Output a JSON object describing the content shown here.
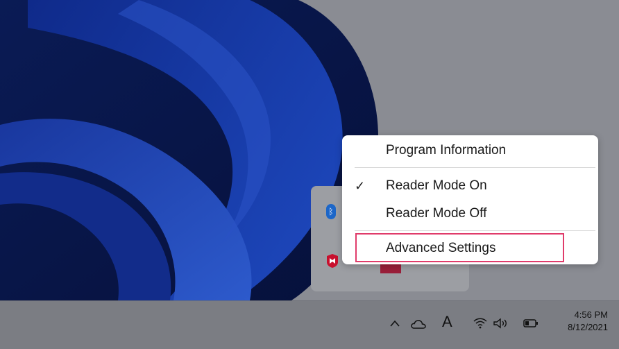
{
  "context_menu": {
    "items": [
      {
        "label": "Program Information",
        "checked": false
      },
      {
        "label": "Reader Mode On",
        "checked": true
      },
      {
        "label": "Reader Mode Off",
        "checked": false
      },
      {
        "label": "Advanced Settings",
        "checked": false,
        "highlighted": true
      }
    ]
  },
  "taskbar": {
    "ime_indicator": "A",
    "time": "4:56 PM",
    "date": "8/12/2021"
  },
  "colors": {
    "highlight": "#e03b6a",
    "bluetooth": "#1c66c8"
  },
  "icons": {
    "tray_overflow": "chevron-up-icon",
    "cloud": "onedrive-icon",
    "wifi": "wifi-icon",
    "volume": "volume-icon",
    "battery": "battery-icon"
  }
}
